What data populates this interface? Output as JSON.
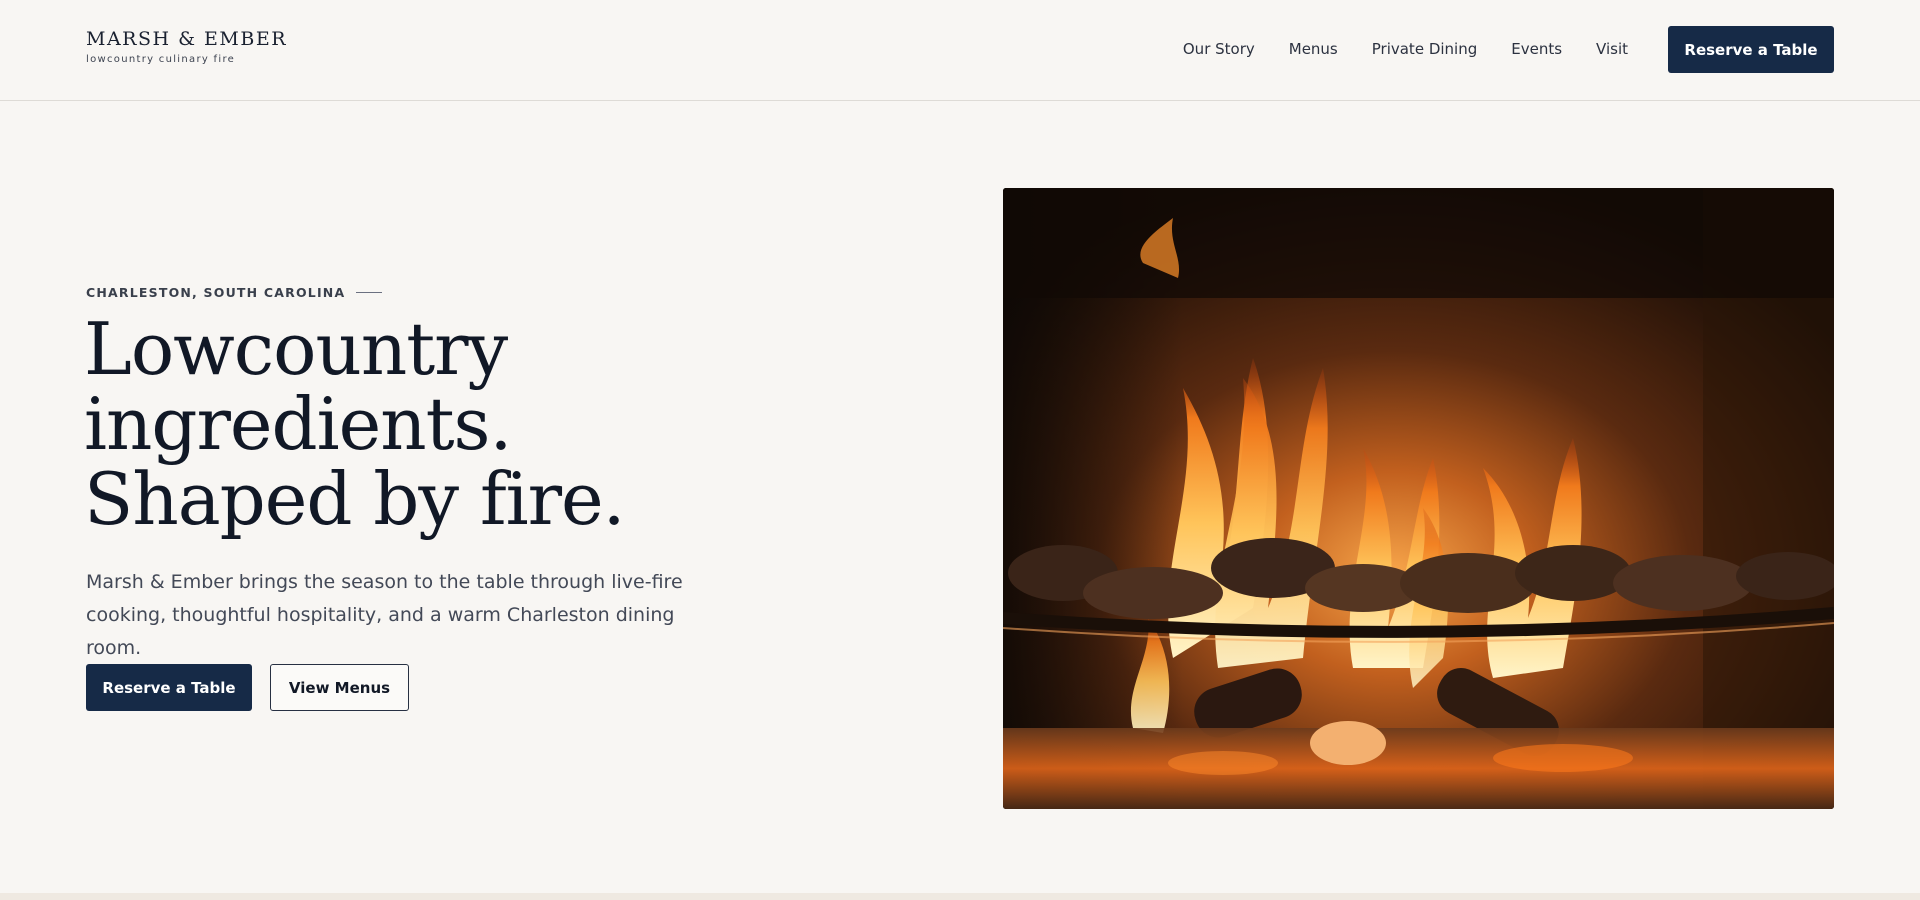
{
  "brand": {
    "name": "MARSH & EMBER",
    "tagline": "lowcountry culinary fire"
  },
  "nav": {
    "items": [
      {
        "label": "Our Story"
      },
      {
        "label": "Menus"
      },
      {
        "label": "Private Dining"
      },
      {
        "label": "Events"
      },
      {
        "label": "Visit"
      }
    ],
    "cta_label": "Reserve a Table"
  },
  "hero": {
    "eyebrow": "CHARLESTON, SOUTH CAROLINA",
    "headline_lines": [
      "Lowcountry",
      "ingredients.",
      "Shaped by fire."
    ],
    "lede": "Marsh & Ember brings the season to the table through live-fire cooking, thoughtful hospitality, and a warm Charleston dining room.",
    "primary_cta": "Reserve a Table",
    "secondary_cta": "View Menus"
  },
  "colors": {
    "page_background": "#f8f6f3",
    "accent_navy": "#162a47",
    "ink": "#111826",
    "fire_orange": "#e8721c"
  }
}
